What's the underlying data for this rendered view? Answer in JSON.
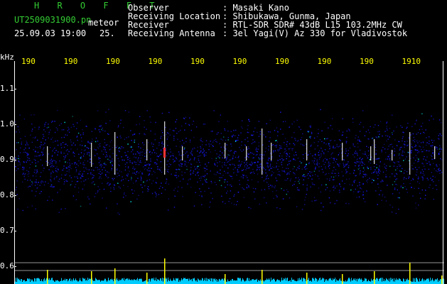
{
  "header": {
    "station": "H R O F F T",
    "filename": "UT2509031900.pn",
    "tag": "meteor",
    "datetime": "25.09.03 19:00",
    "count": "25."
  },
  "info": {
    "observer_label": "Observer",
    "observer_sep": ": ",
    "observer_value": "Masaki Kano",
    "location_label": "Receiving Location",
    "location_sep": ": ",
    "location_value": "Shibukawa, Gunma, Japan",
    "receiver_label": "Receiver",
    "receiver_sep": ": ",
    "receiver_value": "RTL-SDR SDR# 43dB L15 103.2MHz CW",
    "antenna_label": "Receiving Antenna",
    "antenna_sep": ": ",
    "antenna_value": "3el Yagi(V) Az 330 for Vladivostok"
  },
  "axis": {
    "unit": "kHz",
    "y_ticks": [
      "1.1",
      "1.0",
      "0.9",
      "0.8",
      "0.7",
      "0.6"
    ],
    "x_ticks": [
      "190",
      "190",
      "190",
      "190",
      "190",
      "190",
      "190",
      "190",
      "190",
      "1910"
    ]
  },
  "colors": {
    "background": "#000000",
    "noise": "#1a1aff",
    "signal_strong": "#ffffff",
    "signal_mid": "#00ffff",
    "signal_hot": "#ff3333",
    "level_bar": "#ffff00",
    "level_base": "#00ccff"
  }
}
